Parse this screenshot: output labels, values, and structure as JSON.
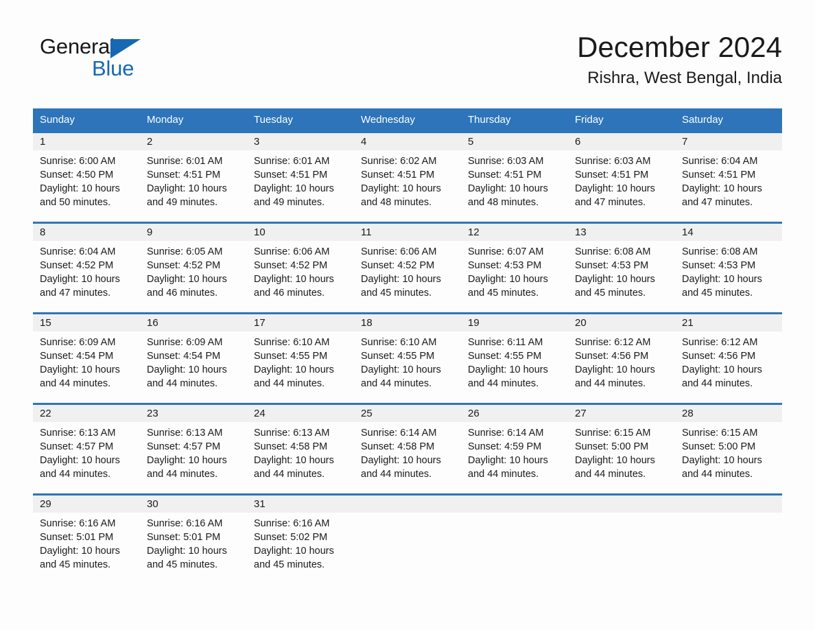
{
  "brand": {
    "name_part1": "General",
    "name_part2": "Blue",
    "flag_icon": "triangle-flag-icon",
    "accent_color": "#1668b3"
  },
  "header": {
    "title": "December 2024",
    "location": "Rishra, West Bengal, India"
  },
  "calendar": {
    "header_bg": "#2d74ba",
    "day_band_bg": "#f0f0f0",
    "weekdays": [
      "Sunday",
      "Monday",
      "Tuesday",
      "Wednesday",
      "Thursday",
      "Friday",
      "Saturday"
    ],
    "weeks": [
      [
        {
          "date": "1",
          "sunrise": "Sunrise: 6:00 AM",
          "sunset": "Sunset: 4:50 PM",
          "daylight_line1": "Daylight: 10 hours",
          "daylight_line2": "and 50 minutes."
        },
        {
          "date": "2",
          "sunrise": "Sunrise: 6:01 AM",
          "sunset": "Sunset: 4:51 PM",
          "daylight_line1": "Daylight: 10 hours",
          "daylight_line2": "and 49 minutes."
        },
        {
          "date": "3",
          "sunrise": "Sunrise: 6:01 AM",
          "sunset": "Sunset: 4:51 PM",
          "daylight_line1": "Daylight: 10 hours",
          "daylight_line2": "and 49 minutes."
        },
        {
          "date": "4",
          "sunrise": "Sunrise: 6:02 AM",
          "sunset": "Sunset: 4:51 PM",
          "daylight_line1": "Daylight: 10 hours",
          "daylight_line2": "and 48 minutes."
        },
        {
          "date": "5",
          "sunrise": "Sunrise: 6:03 AM",
          "sunset": "Sunset: 4:51 PM",
          "daylight_line1": "Daylight: 10 hours",
          "daylight_line2": "and 48 minutes."
        },
        {
          "date": "6",
          "sunrise": "Sunrise: 6:03 AM",
          "sunset": "Sunset: 4:51 PM",
          "daylight_line1": "Daylight: 10 hours",
          "daylight_line2": "and 47 minutes."
        },
        {
          "date": "7",
          "sunrise": "Sunrise: 6:04 AM",
          "sunset": "Sunset: 4:51 PM",
          "daylight_line1": "Daylight: 10 hours",
          "daylight_line2": "and 47 minutes."
        }
      ],
      [
        {
          "date": "8",
          "sunrise": "Sunrise: 6:04 AM",
          "sunset": "Sunset: 4:52 PM",
          "daylight_line1": "Daylight: 10 hours",
          "daylight_line2": "and 47 minutes."
        },
        {
          "date": "9",
          "sunrise": "Sunrise: 6:05 AM",
          "sunset": "Sunset: 4:52 PM",
          "daylight_line1": "Daylight: 10 hours",
          "daylight_line2": "and 46 minutes."
        },
        {
          "date": "10",
          "sunrise": "Sunrise: 6:06 AM",
          "sunset": "Sunset: 4:52 PM",
          "daylight_line1": "Daylight: 10 hours",
          "daylight_line2": "and 46 minutes."
        },
        {
          "date": "11",
          "sunrise": "Sunrise: 6:06 AM",
          "sunset": "Sunset: 4:52 PM",
          "daylight_line1": "Daylight: 10 hours",
          "daylight_line2": "and 45 minutes."
        },
        {
          "date": "12",
          "sunrise": "Sunrise: 6:07 AM",
          "sunset": "Sunset: 4:53 PM",
          "daylight_line1": "Daylight: 10 hours",
          "daylight_line2": "and 45 minutes."
        },
        {
          "date": "13",
          "sunrise": "Sunrise: 6:08 AM",
          "sunset": "Sunset: 4:53 PM",
          "daylight_line1": "Daylight: 10 hours",
          "daylight_line2": "and 45 minutes."
        },
        {
          "date": "14",
          "sunrise": "Sunrise: 6:08 AM",
          "sunset": "Sunset: 4:53 PM",
          "daylight_line1": "Daylight: 10 hours",
          "daylight_line2": "and 45 minutes."
        }
      ],
      [
        {
          "date": "15",
          "sunrise": "Sunrise: 6:09 AM",
          "sunset": "Sunset: 4:54 PM",
          "daylight_line1": "Daylight: 10 hours",
          "daylight_line2": "and 44 minutes."
        },
        {
          "date": "16",
          "sunrise": "Sunrise: 6:09 AM",
          "sunset": "Sunset: 4:54 PM",
          "daylight_line1": "Daylight: 10 hours",
          "daylight_line2": "and 44 minutes."
        },
        {
          "date": "17",
          "sunrise": "Sunrise: 6:10 AM",
          "sunset": "Sunset: 4:55 PM",
          "daylight_line1": "Daylight: 10 hours",
          "daylight_line2": "and 44 minutes."
        },
        {
          "date": "18",
          "sunrise": "Sunrise: 6:10 AM",
          "sunset": "Sunset: 4:55 PM",
          "daylight_line1": "Daylight: 10 hours",
          "daylight_line2": "and 44 minutes."
        },
        {
          "date": "19",
          "sunrise": "Sunrise: 6:11 AM",
          "sunset": "Sunset: 4:55 PM",
          "daylight_line1": "Daylight: 10 hours",
          "daylight_line2": "and 44 minutes."
        },
        {
          "date": "20",
          "sunrise": "Sunrise: 6:12 AM",
          "sunset": "Sunset: 4:56 PM",
          "daylight_line1": "Daylight: 10 hours",
          "daylight_line2": "and 44 minutes."
        },
        {
          "date": "21",
          "sunrise": "Sunrise: 6:12 AM",
          "sunset": "Sunset: 4:56 PM",
          "daylight_line1": "Daylight: 10 hours",
          "daylight_line2": "and 44 minutes."
        }
      ],
      [
        {
          "date": "22",
          "sunrise": "Sunrise: 6:13 AM",
          "sunset": "Sunset: 4:57 PM",
          "daylight_line1": "Daylight: 10 hours",
          "daylight_line2": "and 44 minutes."
        },
        {
          "date": "23",
          "sunrise": "Sunrise: 6:13 AM",
          "sunset": "Sunset: 4:57 PM",
          "daylight_line1": "Daylight: 10 hours",
          "daylight_line2": "and 44 minutes."
        },
        {
          "date": "24",
          "sunrise": "Sunrise: 6:13 AM",
          "sunset": "Sunset: 4:58 PM",
          "daylight_line1": "Daylight: 10 hours",
          "daylight_line2": "and 44 minutes."
        },
        {
          "date": "25",
          "sunrise": "Sunrise: 6:14 AM",
          "sunset": "Sunset: 4:58 PM",
          "daylight_line1": "Daylight: 10 hours",
          "daylight_line2": "and 44 minutes."
        },
        {
          "date": "26",
          "sunrise": "Sunrise: 6:14 AM",
          "sunset": "Sunset: 4:59 PM",
          "daylight_line1": "Daylight: 10 hours",
          "daylight_line2": "and 44 minutes."
        },
        {
          "date": "27",
          "sunrise": "Sunrise: 6:15 AM",
          "sunset": "Sunset: 5:00 PM",
          "daylight_line1": "Daylight: 10 hours",
          "daylight_line2": "and 44 minutes."
        },
        {
          "date": "28",
          "sunrise": "Sunrise: 6:15 AM",
          "sunset": "Sunset: 5:00 PM",
          "daylight_line1": "Daylight: 10 hours",
          "daylight_line2": "and 44 minutes."
        }
      ],
      [
        {
          "date": "29",
          "sunrise": "Sunrise: 6:16 AM",
          "sunset": "Sunset: 5:01 PM",
          "daylight_line1": "Daylight: 10 hours",
          "daylight_line2": "and 45 minutes."
        },
        {
          "date": "30",
          "sunrise": "Sunrise: 6:16 AM",
          "sunset": "Sunset: 5:01 PM",
          "daylight_line1": "Daylight: 10 hours",
          "daylight_line2": "and 45 minutes."
        },
        {
          "date": "31",
          "sunrise": "Sunrise: 6:16 AM",
          "sunset": "Sunset: 5:02 PM",
          "daylight_line1": "Daylight: 10 hours",
          "daylight_line2": "and 45 minutes."
        },
        {
          "date": "",
          "sunrise": "",
          "sunset": "",
          "daylight_line1": "",
          "daylight_line2": ""
        },
        {
          "date": "",
          "sunrise": "",
          "sunset": "",
          "daylight_line1": "",
          "daylight_line2": ""
        },
        {
          "date": "",
          "sunrise": "",
          "sunset": "",
          "daylight_line1": "",
          "daylight_line2": ""
        },
        {
          "date": "",
          "sunrise": "",
          "sunset": "",
          "daylight_line1": "",
          "daylight_line2": ""
        }
      ]
    ]
  }
}
